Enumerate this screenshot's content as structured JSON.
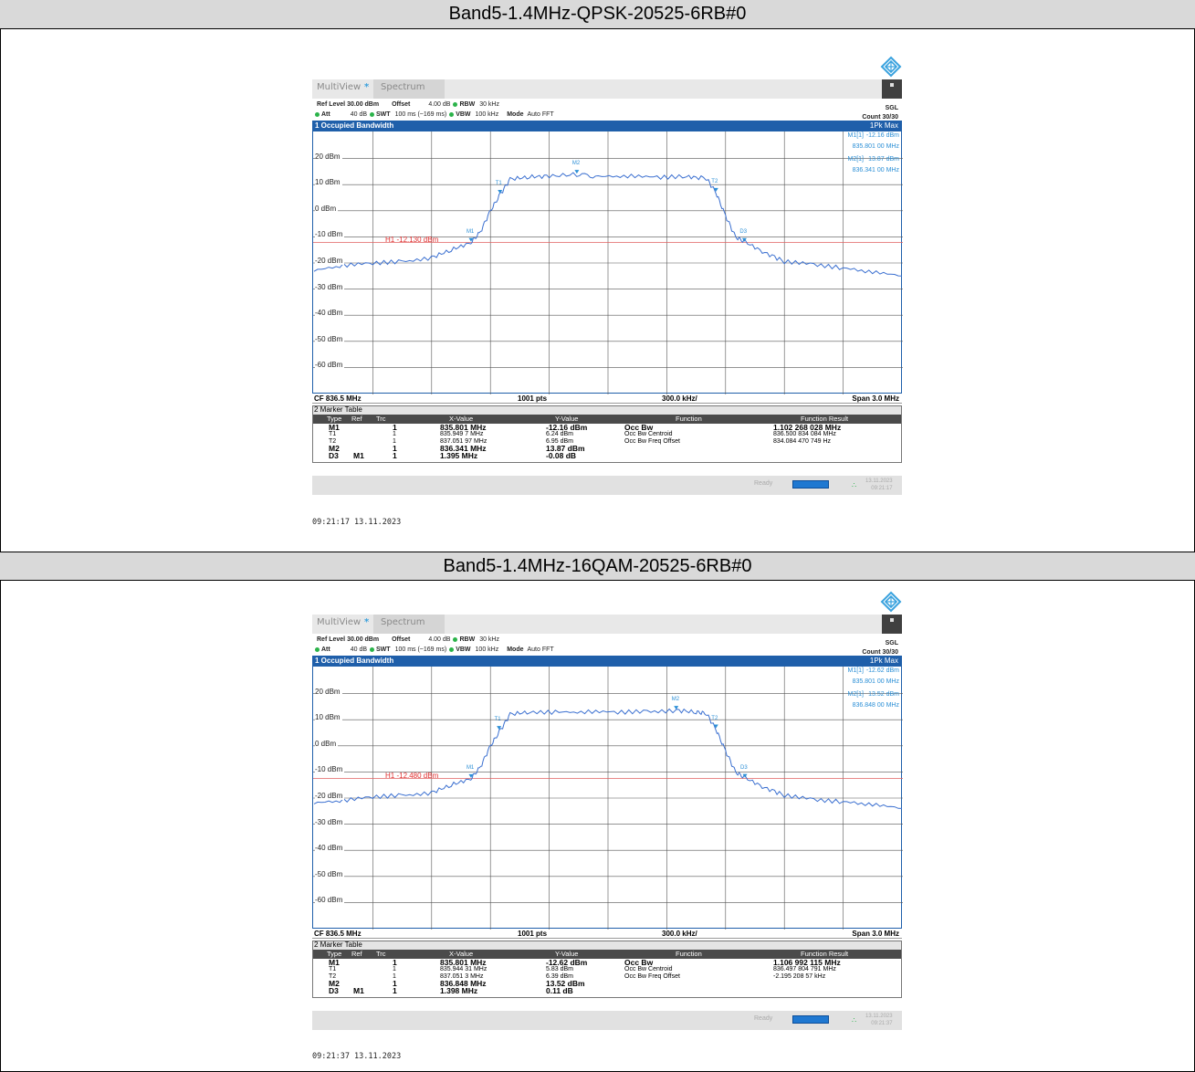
{
  "sections": [
    {
      "caption": "Band5-1.4MHz-QPSK-20525-6RB#0",
      "tabs": {
        "multiview": "MultiView",
        "star": "*",
        "spectrum": "Spectrum"
      },
      "params": {
        "ref_level": "Ref Level 30.00 dBm",
        "offset_label": "Offset",
        "offset_value": "4.00 dB",
        "rbw_label": "RBW",
        "rbw_value": "30 kHz",
        "att": "Att",
        "att_value": "40 dB",
        "swt_label": "SWT",
        "swt_value": "100 ms (~169 ms)",
        "vbw_label": "VBW",
        "vbw_value": "100 kHz",
        "mode_label": "Mode",
        "mode_value": "Auto FFT",
        "sgl": "SGL",
        "count": "Count 30/30"
      },
      "panel_title": "1 Occupied Bandwidth",
      "trace_mode": "1Pk Max",
      "marker_readouts": [
        {
          "name": "M1[1]",
          "level": "-12.16 dBm",
          "freq": "835.801 00 MHz"
        },
        {
          "name": "M2[1]",
          "level": "13.87 dBm",
          "freq": "836.341 00 MHz"
        }
      ],
      "y_ticks": [
        "20 dBm",
        "10 dBm",
        "0 dBm",
        "-10 dBm",
        "-20 dBm",
        "-30 dBm",
        "-40 dBm",
        "-50 dBm",
        "-60 dBm"
      ],
      "h1_label": "H1 -12.130 dBm",
      "plot_markers": [
        "M1",
        "M2",
        "T1",
        "T2",
        "D3"
      ],
      "footer": {
        "cf": "CF 836.5 MHz",
        "pts": "1001 pts",
        "div": "300.0 kHz/",
        "span": "Span 3.0 MHz"
      },
      "marker_table_title": "2 Marker Table",
      "marker_table_headers": [
        "Type",
        "Ref",
        "Trc",
        "X-Value",
        "Y-Value",
        "Function",
        "Function Result"
      ],
      "marker_table_rows": [
        [
          "M1",
          "",
          "1",
          "835.801 MHz",
          "-12.16 dBm",
          "Occ Bw",
          "1.102 268 028 MHz"
        ],
        [
          "T1",
          "",
          "1",
          "835.949 7 MHz",
          "6.24 dBm",
          "Occ Bw Centroid",
          "836.500 834 084 MHz"
        ],
        [
          "T2",
          "",
          "1",
          "837.051 97 MHz",
          "6.95 dBm",
          "Occ Bw Freq Offset",
          "834.084 470 749 Hz"
        ],
        [
          "M2",
          "",
          "1",
          "836.341 MHz",
          "13.87 dBm",
          "",
          ""
        ],
        [
          "D3",
          "M1",
          "1",
          "1.395 MHz",
          "-0.08 dB",
          "",
          ""
        ]
      ],
      "status": {
        "ready": "Ready",
        "date": "13.11.2023",
        "time": "09:21:17"
      },
      "timestamp": "09:21:17  13.11.2023",
      "chart_data": {
        "type": "line",
        "xlabel": "",
        "ylabel": "",
        "xlim_mhz": [
          835.0,
          838.0
        ],
        "ylim": [
          -70,
          30
        ],
        "series": [
          {
            "x": [
              835.0,
              835.15,
              835.3,
              835.45,
              835.6,
              835.7,
              835.8,
              835.85,
              835.9,
              835.95,
              836.0,
              836.1,
              836.2,
              836.34,
              836.45,
              836.6,
              836.75,
              836.9,
              837.0,
              837.05,
              837.1,
              837.15,
              837.2,
              837.3,
              837.4,
              837.55,
              837.7,
              837.85,
              838.0
            ],
            "y": [
              -23,
              -21,
              -20,
              -19.5,
              -18,
              -15,
              -12.2,
              -8,
              0,
              6.2,
              12,
              13,
              13.2,
              13.9,
              13,
              13.3,
              12.8,
              13.1,
              12.5,
              7,
              -2,
              -10,
              -12,
              -16,
              -19.5,
              -20.5,
              -22,
              -23.5,
              -25
            ]
          }
        ],
        "h1_dbm": -12.13
      }
    },
    {
      "caption": "Band5-1.4MHz-16QAM-20525-6RB#0",
      "tabs": {
        "multiview": "MultiView",
        "star": "*",
        "spectrum": "Spectrum"
      },
      "params": {
        "ref_level": "Ref Level 30.00 dBm",
        "offset_label": "Offset",
        "offset_value": "4.00 dB",
        "rbw_label": "RBW",
        "rbw_value": "30 kHz",
        "att": "Att",
        "att_value": "40 dB",
        "swt_label": "SWT",
        "swt_value": "100 ms (~169 ms)",
        "vbw_label": "VBW",
        "vbw_value": "100 kHz",
        "mode_label": "Mode",
        "mode_value": "Auto FFT",
        "sgl": "SGL",
        "count": "Count 30/30"
      },
      "panel_title": "1 Occupied Bandwidth",
      "trace_mode": "1Pk Max",
      "marker_readouts": [
        {
          "name": "M1[1]",
          "level": "-12.62 dBm",
          "freq": "835.801 00 MHz"
        },
        {
          "name": "M2[1]",
          "level": "13.52 dBm",
          "freq": "836.848 00 MHz"
        }
      ],
      "y_ticks": [
        "20 dBm",
        "10 dBm",
        "0 dBm",
        "-10 dBm",
        "-20 dBm",
        "-30 dBm",
        "-40 dBm",
        "-50 dBm",
        "-60 dBm"
      ],
      "h1_label": "H1 -12.480 dBm",
      "plot_markers": [
        "M1",
        "M2",
        "T1",
        "T2",
        "D3"
      ],
      "footer": {
        "cf": "CF 836.5 MHz",
        "pts": "1001 pts",
        "div": "300.0 kHz/",
        "span": "Span 3.0 MHz"
      },
      "marker_table_title": "2 Marker Table",
      "marker_table_headers": [
        "Type",
        "Ref",
        "Trc",
        "X-Value",
        "Y-Value",
        "Function",
        "Function Result"
      ],
      "marker_table_rows": [
        [
          "M1",
          "",
          "1",
          "835.801 MHz",
          "-12.62 dBm",
          "Occ Bw",
          "1.106 992 115 MHz"
        ],
        [
          "T1",
          "",
          "1",
          "835.944 31 MHz",
          "5.83 dBm",
          "Occ Bw Centroid",
          "836.497 804 791 MHz"
        ],
        [
          "T2",
          "",
          "1",
          "837.051 3 MHz",
          "6.39 dBm",
          "Occ Bw Freq Offset",
          "-2.195 208 57 kHz"
        ],
        [
          "M2",
          "",
          "1",
          "836.848 MHz",
          "13.52 dBm",
          "",
          ""
        ],
        [
          "D3",
          "M1",
          "1",
          "1.398 MHz",
          "0.11 dB",
          "",
          ""
        ]
      ],
      "status": {
        "ready": "Ready",
        "date": "13.11.2023",
        "time": "09:21:37"
      },
      "timestamp": "09:21:37  13.11.2023",
      "chart_data": {
        "type": "line",
        "xlabel": "",
        "ylabel": "",
        "xlim_mhz": [
          835.0,
          838.0
        ],
        "ylim": [
          -70,
          30
        ],
        "series": [
          {
            "x": [
              835.0,
              835.15,
              835.3,
              835.45,
              835.6,
              835.7,
              835.8,
              835.85,
              835.9,
              835.95,
              836.0,
              836.1,
              836.25,
              836.4,
              836.55,
              836.7,
              836.85,
              836.95,
              837.0,
              837.05,
              837.1,
              837.15,
              837.2,
              837.3,
              837.4,
              837.55,
              837.7,
              837.85,
              838.0
            ],
            "y": [
              -22,
              -21,
              -19.5,
              -19,
              -18,
              -15,
              -12.6,
              -8,
              0,
              5.8,
              12,
              13,
              12.8,
              13,
              12.9,
              13.1,
              13.5,
              12.9,
              12.5,
              6.4,
              -2,
              -10,
              -12.3,
              -16,
              -19,
              -20.5,
              -21.5,
              -22.5,
              -24
            ]
          }
        ],
        "h1_dbm": -12.48
      }
    }
  ]
}
